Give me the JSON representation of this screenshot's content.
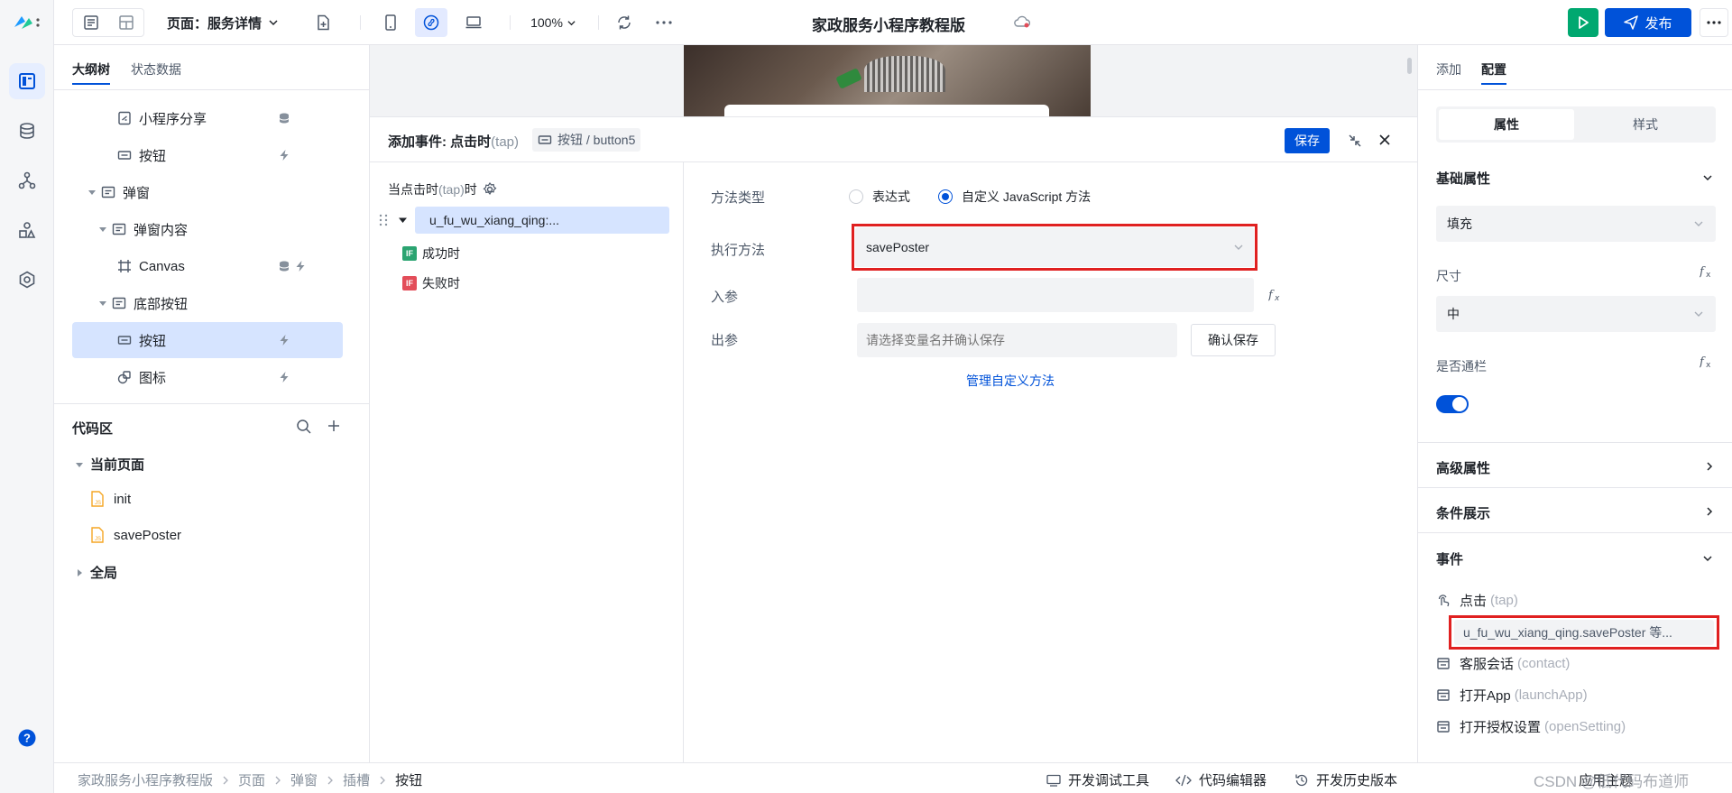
{
  "topbar": {
    "page_label": "页面：服务详情",
    "zoom": "100%",
    "app_title": "家政服务小程序教程版",
    "publish_label": "发布"
  },
  "outline": {
    "tabs": [
      "大纲树",
      "状态数据"
    ],
    "tree": [
      {
        "label": "小程序分享",
        "icon": "share-page-icon",
        "badges": [
          "database-icon"
        ]
      },
      {
        "label": "按钮",
        "icon": "button-component-icon",
        "badges": [
          "lightning-icon"
        ]
      },
      {
        "label": "弹窗",
        "icon": "container-icon",
        "badges": []
      },
      {
        "label": "弹窗内容",
        "icon": "container-icon",
        "badges": []
      },
      {
        "label": "Canvas",
        "icon": "canvas-icon",
        "badges": [
          "database-icon",
          "lightning-icon"
        ]
      },
      {
        "label": "底部按钮",
        "icon": "container-icon",
        "badges": []
      },
      {
        "label": "按钮",
        "icon": "button-component-icon",
        "badges": [
          "lightning-icon"
        ],
        "selected": true
      },
      {
        "label": "图标",
        "icon": "image-component-icon",
        "badges": [
          "lightning-icon"
        ]
      }
    ],
    "code_section": {
      "title": "代码区",
      "current_page": "当前页面",
      "files": [
        "init",
        "savePoster"
      ],
      "global": "全局"
    }
  },
  "dialog": {
    "title": "添加事件: 点击时",
    "title_event": "(tap)",
    "target_path": "按钮 / button5",
    "save_label": "保存",
    "when_label": "当点击时",
    "when_event": "(tap)",
    "when_suffix": "时",
    "action_node": "u_fu_wu_xiang_qing:...",
    "success_label": "成功时",
    "fail_label": "失败时",
    "if_badge": "IF",
    "method_type_label": "方法类型",
    "method_type_options": [
      "表达式",
      "自定义 JavaScript 方法"
    ],
    "method_type_selected": "自定义 JavaScript 方法",
    "exec_method_label": "执行方法",
    "exec_method_value": "savePoster",
    "params_in_label": "入参",
    "params_out_label": "出参",
    "params_out_placeholder": "请选择变量名并确认保存",
    "confirm_save_label": "确认保存",
    "manage_link": "管理自定义方法"
  },
  "config": {
    "tabs": [
      "添加",
      "配置"
    ],
    "segment": [
      "属性",
      "样式"
    ],
    "basic_props_title": "基础属性",
    "fill_value": "填充",
    "size_label": "尺寸",
    "size_value": "中",
    "full_width_label": "是否通栏",
    "full_width_on": true,
    "advanced_title": "高级属性",
    "conditional_title": "条件展示",
    "events_title": "事件",
    "events": [
      {
        "label": "点击",
        "event": "(tap)"
      },
      {
        "label": "客服会话",
        "event": "(contact)"
      },
      {
        "label": "打开App",
        "event": "(launchApp)"
      },
      {
        "label": "打开授权设置",
        "event": "(openSetting)"
      }
    ],
    "bound_action": "u_fu_wu_xiang_qing.savePoster 等..."
  },
  "bottombar": {
    "breadcrumb": [
      "家政服务小程序教程版",
      "页面",
      "弹窗",
      "插槽",
      "按钮"
    ],
    "dev_tools": "开发调试工具",
    "code_editor": "代码编辑器",
    "history": "开发历史版本",
    "apply_theme": "应用主题",
    "watermark": "CSDN @低代码布道师"
  },
  "colors": {
    "accent": "#0052d9",
    "run_green": "#00a870",
    "highlight_red": "#e02020",
    "if_green": "#2ba471",
    "if_red": "#e34d59"
  }
}
